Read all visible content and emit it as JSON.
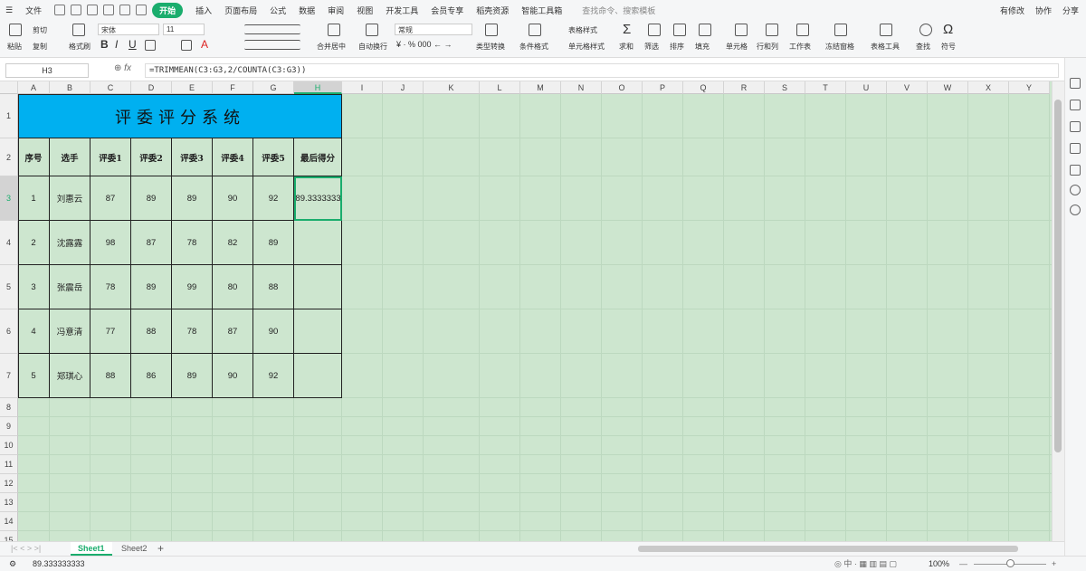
{
  "menu": {
    "items": [
      "文件",
      "开始",
      "插入",
      "页面布局",
      "公式",
      "数据",
      "审阅",
      "视图",
      "开发工具",
      "会员专享",
      "稻壳资源",
      "智能工具箱"
    ],
    "active": "开始",
    "search": "查找命令、搜索模板",
    "right": [
      "有修改",
      "协作",
      "分享"
    ]
  },
  "ribbon": {
    "paste": "粘贴",
    "cut": "剪切",
    "copy": "复制",
    "format_painter": "格式刷",
    "font": "宋体",
    "size": "11",
    "bold": "B",
    "italic": "I",
    "underline": "U",
    "merge": "合并居中",
    "wrap": "自动换行",
    "numfmt": "常规",
    "type_convert": "类型转换",
    "cond_format": "条件格式",
    "table_style": "表格样式",
    "cell_style": "单元格样式",
    "sum": "求和",
    "filter": "筛选",
    "sort": "排序",
    "fill": "填充",
    "cell": "单元格",
    "rowcol": "行和列",
    "worksheet": "工作表",
    "freeze": "冻结窗格",
    "table_tools": "表格工具",
    "find": "查找",
    "symbol": "符号"
  },
  "formula_bar": {
    "cell_ref": "H3",
    "fx": "fx",
    "formula": "=TRIMMEAN(C3:G3,2/COUNTA(C3:G3))"
  },
  "sheet": {
    "columns": [
      "A",
      "B",
      "C",
      "D",
      "E",
      "F",
      "G",
      "H",
      "I",
      "J",
      "K",
      "L",
      "M",
      "N",
      "O",
      "P",
      "Q",
      "R",
      "S",
      "T",
      "U",
      "V",
      "W",
      "X",
      "Y"
    ],
    "rows": [
      "1",
      "2",
      "3",
      "4",
      "5",
      "6",
      "7",
      "8",
      "9",
      "10",
      "11",
      "12",
      "13",
      "14",
      "15"
    ],
    "title": "评委评分系统",
    "headers": [
      "序号",
      "选手",
      "评委1",
      "评委2",
      "评委3",
      "评委4",
      "评委5",
      "最后得分"
    ],
    "data": [
      [
        "1",
        "刘惠云",
        "87",
        "89",
        "89",
        "90",
        "92",
        "89.3333333"
      ],
      [
        "2",
        "沈露露",
        "98",
        "87",
        "78",
        "82",
        "89",
        ""
      ],
      [
        "3",
        "张震岳",
        "78",
        "89",
        "99",
        "80",
        "88",
        ""
      ],
      [
        "4",
        "冯意清",
        "77",
        "88",
        "78",
        "87",
        "90",
        ""
      ],
      [
        "5",
        "郑琪心",
        "88",
        "86",
        "89",
        "90",
        "92",
        ""
      ]
    ]
  },
  "tabs": [
    "Sheet1",
    "Sheet2"
  ],
  "active_tab": "Sheet1",
  "status": {
    "value": "89.333333333",
    "zoom": "100%"
  },
  "colors": {
    "accent": "#1aad6d",
    "title_fill": "#00b0f0",
    "sheet_bg": "#cde6cf"
  }
}
